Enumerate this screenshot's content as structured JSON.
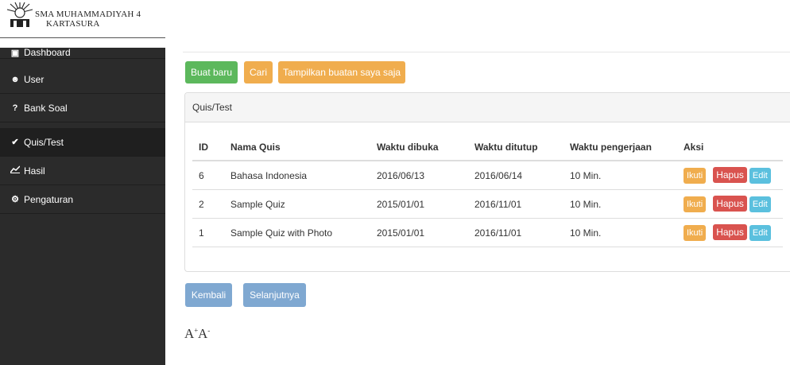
{
  "header": {
    "school_line1": "SMA MUHAMMADIYAH 4",
    "school_line2": "KARTASURA"
  },
  "sidebar": {
    "items": [
      {
        "label": "Dashboard",
        "icon": "dashboard-icon"
      },
      {
        "label": "User",
        "icon": "users-icon"
      },
      {
        "label": "Bank Soal",
        "icon": "question-icon"
      },
      {
        "label": "Quis/Test",
        "icon": "check-icon",
        "active": true
      },
      {
        "label": "Hasil",
        "icon": "line-chart-icon"
      },
      {
        "label": "Pengaturan",
        "icon": "gear-icon"
      }
    ]
  },
  "toolbar": {
    "buat_baru": "Buat baru",
    "cari": "Cari",
    "tampilkan": "Tampilkan buatan saya saja"
  },
  "panel": {
    "title": "Quis/Test",
    "columns": [
      "ID",
      "Nama Quis",
      "Waktu dibuka",
      "Waktu ditutup",
      "Waktu pengerjaan",
      "Aksi"
    ],
    "rows": [
      {
        "id": "6",
        "nama": "Bahasa Indonesia",
        "dibuka": "2016/06/13",
        "ditutup": "2016/06/14",
        "pengerjaan": "10 Min."
      },
      {
        "id": "2",
        "nama": "Sample Quiz",
        "dibuka": "2015/01/01",
        "ditutup": "2016/11/01",
        "pengerjaan": "10 Min."
      },
      {
        "id": "1",
        "nama": "Sample Quiz with Photo",
        "dibuka": "2015/01/01",
        "ditutup": "2016/11/01",
        "pengerjaan": "10 Min."
      }
    ],
    "actions": {
      "ikuti": "Ikuti",
      "hapus": "Hapus",
      "edit": "Edit"
    }
  },
  "pagination": {
    "prev": "Kembali",
    "next": "Selanjutnya"
  },
  "font_controls": {
    "increase": "A",
    "increase_mark": "+",
    "decrease": "A",
    "decrease_mark": "-"
  },
  "colors": {
    "sidebar_bg": "#2b2b2b",
    "success": "#5cb85c",
    "warning": "#f0ad4e",
    "danger": "#d9534f",
    "info": "#5bc0de",
    "primary_disabled": "#7fa8d1"
  }
}
